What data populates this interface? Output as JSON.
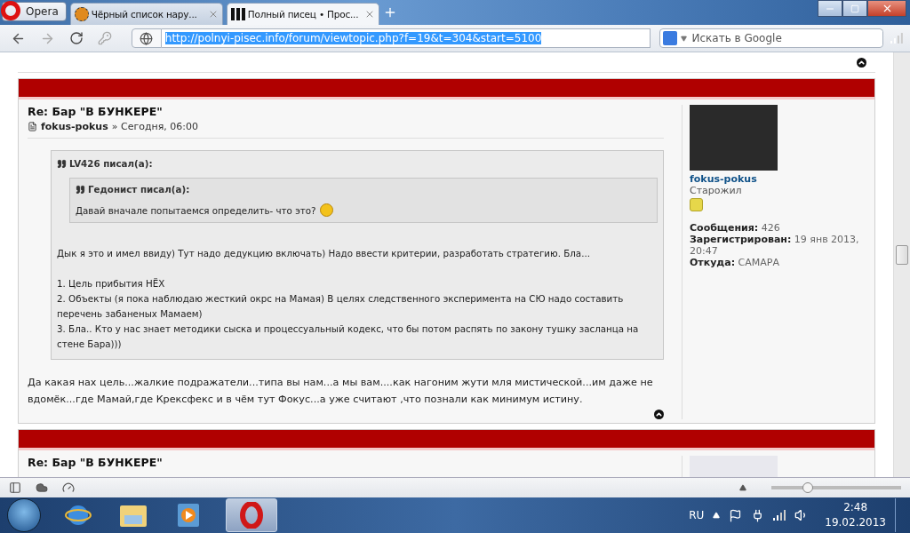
{
  "browser": {
    "menu_button": "Opera",
    "tabs": [
      {
        "title": "Чёрный список нару...",
        "selected": false
      },
      {
        "title": "Полный писец • Прос...",
        "selected": true
      }
    ],
    "address": "http://polnyi-pisec.info/forum/viewtopic.php?f=19&t=304&start=5100",
    "search": {
      "placeholder": "Искать в Google"
    }
  },
  "posts": [
    {
      "title": "Re: Бар \"В БУНКЕРЕ\"",
      "author": "fokus-pokus",
      "meta": "» Сегодня, 06:00",
      "quote": {
        "header": "LV426 писал(а):",
        "inner_quote": {
          "header": "Гедонист писал(а):",
          "text": "Давай вначале попытаемся определить- что это?"
        },
        "paragraphs": [
          [
            "Дык я это и имел ввиду) Тут надо дедукцию включать) Надо ввести критерии, разработать стратегию. Бла..."
          ],
          [
            "1. Цель прибытия НЁХ",
            "2. Объекты (я пока наблюдаю жесткий окрс на Мамая) В целях следственного эксперимента на СЮ надо составить перечень забаненых Мамаем)",
            "3. Бла.. Кто у нас знает методики сыска и процессуальный кодекс, что бы потом распять по закону тушку засланца на стене Бара)))"
          ]
        ]
      },
      "text": "Да какая нах цель...жалкие подражатели...типа вы нам...а мы вам....как нагоним жути мля мистической...им даже не вдомёк...где Мамай,где Крексфекс и в чём тут Фокус...а уже считают ,что познали как минимум истину.",
      "profile": {
        "name": "fokus-pokus",
        "rank": "Старожил",
        "stats": [
          {
            "label": "Сообщения:",
            "value": "426"
          },
          {
            "label": "Зарегистрирован:",
            "value": "19 янв 2013, 20:47"
          },
          {
            "label": "Откуда:",
            "value": "САМАРА"
          }
        ]
      }
    },
    {
      "title": "Re: Бар \"В БУНКЕРЕ\""
    }
  ],
  "zoom": {
    "level": 0.28
  },
  "taskbar": {
    "language": "RU",
    "time": "2:48",
    "date": "19.02.2013"
  }
}
